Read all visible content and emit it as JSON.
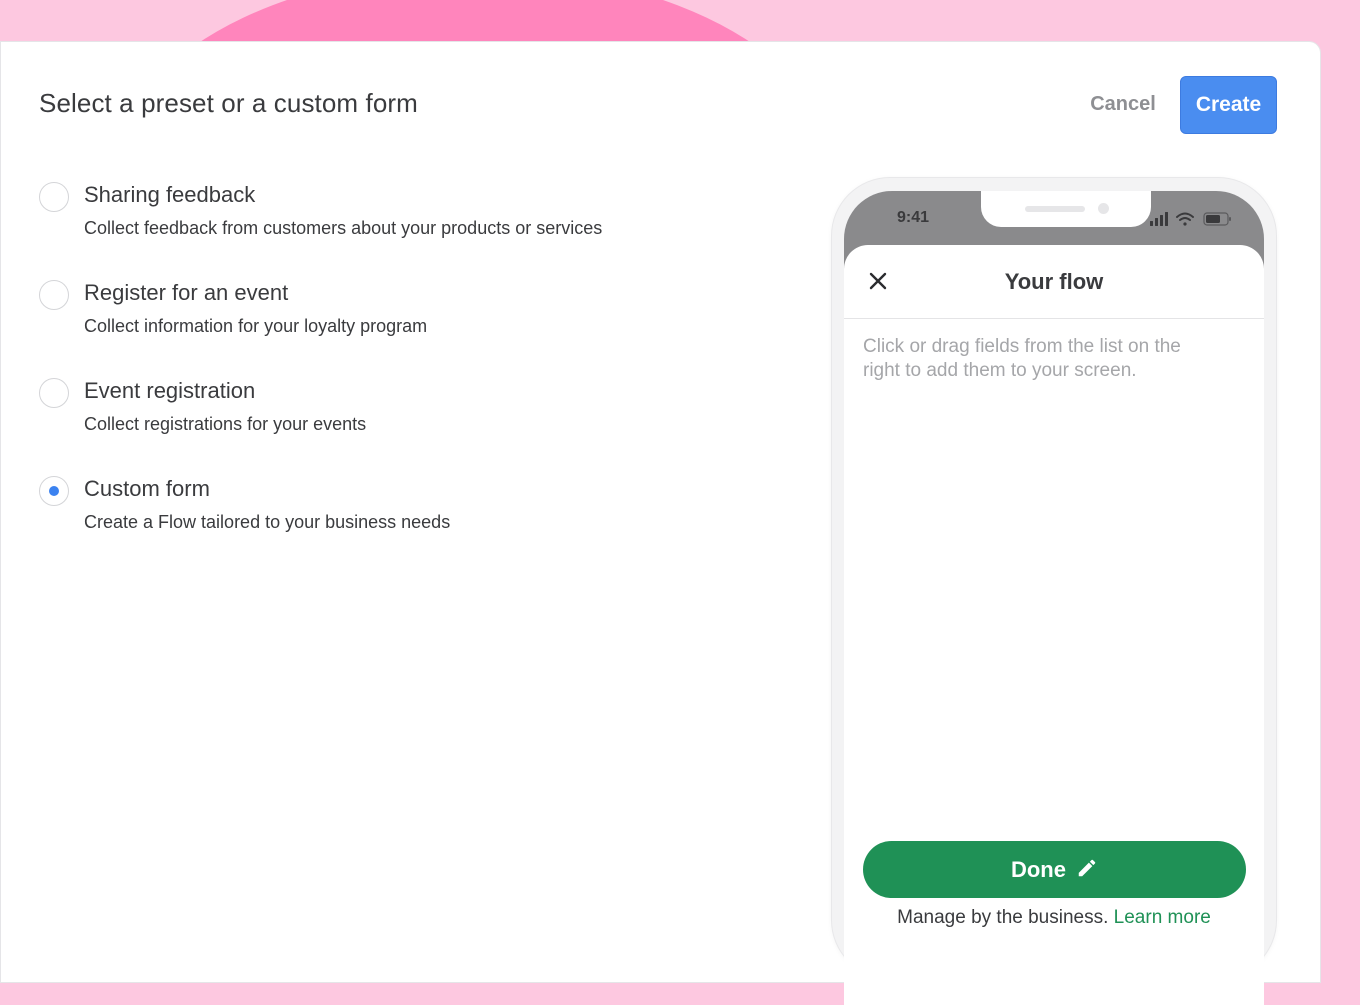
{
  "dialog": {
    "title": "Select a preset or a custom form",
    "cancel_label": "Cancel",
    "create_label": "Create"
  },
  "options": [
    {
      "title": "Sharing feedback",
      "description": "Collect feedback from customers about your products or services",
      "selected": false
    },
    {
      "title": "Register for an event",
      "description": "Collect information for your loyalty program",
      "selected": false
    },
    {
      "title": "Event registration",
      "description": "Collect registrations for your events",
      "selected": false
    },
    {
      "title": "Custom form",
      "description": "Create a Flow tailored to your business needs",
      "selected": true
    }
  ],
  "preview": {
    "status_time": "9:41",
    "icons": [
      "signal-icon",
      "wifi-icon",
      "battery-icon",
      "close-icon",
      "pencil-icon"
    ],
    "flow_title": "Your flow",
    "placeholder": "Click or drag fields from the list on the right to add them to your screen.",
    "done_label": "Done",
    "footer_text": "Manage by the business.",
    "learn_more": "Learn more"
  },
  "colors": {
    "background": "#fdc8e0",
    "accent_pink": "#ff85bc",
    "primary_blue": "#4a8df0",
    "whatsapp_green": "#1f9156",
    "status_bar": "#8a8a8c"
  }
}
